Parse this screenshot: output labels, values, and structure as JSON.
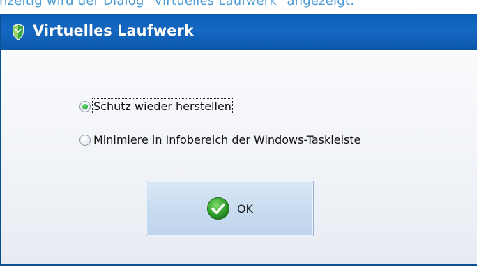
{
  "caption": "nzeitig wird der Dialog \"Virtuelles Laufwerk\" angezeigt:",
  "dialog": {
    "title": "Virtuelles Laufwerk",
    "title_icon": "shield-icon",
    "options": [
      {
        "label": "Schutz wieder herstellen",
        "checked": true
      },
      {
        "label": "Minimiere in Infobereich der Windows-Taskleiste",
        "checked": false
      }
    ],
    "ok_label": "OK",
    "ok_icon": "checkmark-icon"
  },
  "colors": {
    "titlebar": "#0a5fb4",
    "caption_text": "#4a9ad6",
    "radio_checked": "#1ea334"
  }
}
